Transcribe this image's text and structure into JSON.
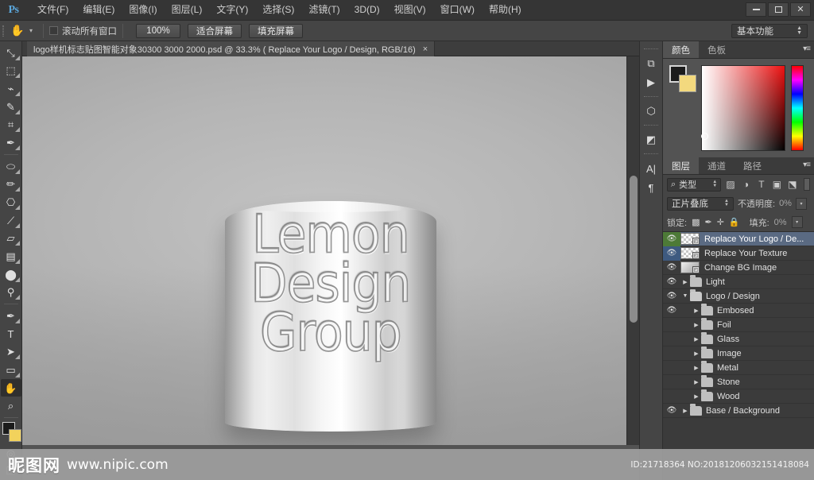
{
  "app": {
    "logo": "Ps",
    "window_controls": {
      "minimize": "—",
      "maximize": "❐",
      "close": "✕"
    }
  },
  "menubar": {
    "items": [
      {
        "label": "文件(F)"
      },
      {
        "label": "编辑(E)"
      },
      {
        "label": "图像(I)"
      },
      {
        "label": "图层(L)"
      },
      {
        "label": "文字(Y)"
      },
      {
        "label": "选择(S)"
      },
      {
        "label": "滤镜(T)"
      },
      {
        "label": "3D(D)"
      },
      {
        "label": "视图(V)"
      },
      {
        "label": "窗口(W)"
      },
      {
        "label": "帮助(H)"
      }
    ]
  },
  "options_bar": {
    "tool_icon": "hand-tool-icon",
    "scroll_all_windows_label": "滚动所有窗口",
    "scroll_all_windows_checked": false,
    "buttons": [
      {
        "label": "100%"
      },
      {
        "label": "适合屏幕"
      },
      {
        "label": "填充屏幕"
      }
    ],
    "workspace": {
      "value": "基本功能"
    }
  },
  "toolbar": {
    "tools": [
      {
        "name": "move-tool",
        "glyph": "↖"
      },
      {
        "name": "rectangular-marquee-tool",
        "glyph": "⬚"
      },
      {
        "name": "lasso-tool",
        "glyph": "☄"
      },
      {
        "name": "quick-selection-tool",
        "glyph": "✎"
      },
      {
        "name": "crop-tool",
        "glyph": "⛏"
      },
      {
        "name": "eyedropper-tool",
        "glyph": "✐"
      },
      {
        "name": "spot-healing-brush-tool",
        "glyph": "Ὀa"
      },
      {
        "name": "brush-tool",
        "glyph": "✏"
      },
      {
        "name": "clone-stamp-tool",
        "glyph": "⚒"
      },
      {
        "name": "history-brush-tool",
        "glyph": "☙"
      },
      {
        "name": "eraser-tool",
        "glyph": "▱"
      },
      {
        "name": "gradient-tool",
        "glyph": "▤"
      },
      {
        "name": "blur-tool",
        "glyph": "●"
      },
      {
        "name": "dodge-tool",
        "glyph": "⚲"
      },
      {
        "name": "pen-tool",
        "glyph": "✒"
      },
      {
        "name": "horizontal-type-tool",
        "glyph": "T"
      },
      {
        "name": "path-selection-tool",
        "glyph": "➤"
      },
      {
        "name": "rectangle-shape-tool",
        "glyph": "▭"
      },
      {
        "name": "hand-tool",
        "glyph": "✋",
        "active": true
      },
      {
        "name": "zoom-tool",
        "glyph": "⌕"
      }
    ],
    "quick_mask_glyph": "◎",
    "screen_mode_glyph": "❐",
    "foreground_color": "#1b1b1b",
    "background_color": "#f2d25c"
  },
  "document": {
    "tab_title": "logo样机标志贴图智能对象30300 3000 2000.psd @ 33.3% ( Replace Your Logo / Design, RGB/16)",
    "close_glyph": "×"
  },
  "canvas": {
    "mockup_text": "Lemon\nDesign\nGroup"
  },
  "icon_dock": {
    "icons": [
      {
        "name": "history-panel-icon",
        "glyph": "⧉"
      },
      {
        "name": "actions-play-icon",
        "glyph": "▶"
      },
      {
        "name": "3d-panel-icon",
        "glyph": "⬡"
      },
      {
        "name": "adjustments-panel-icon",
        "glyph": "◧"
      },
      {
        "name": "character-panel-icon",
        "glyph": "A"
      },
      {
        "name": "paragraph-panel-icon",
        "glyph": "¶"
      }
    ]
  },
  "color_panel": {
    "tabs": [
      {
        "label": "颜色",
        "active": true
      },
      {
        "label": "色板",
        "active": false
      }
    ],
    "menu_glyph": "▾≡",
    "foreground_color": "#1c1c1c",
    "background_color": "#f3d97e",
    "picker_base_color": "#ee1111"
  },
  "layers_panel": {
    "tabs": [
      {
        "label": "图层",
        "active": true
      },
      {
        "label": "通道",
        "active": false
      },
      {
        "label": "路径",
        "active": false
      }
    ],
    "menu_glyph": "▾≡",
    "filter": {
      "label": "类型",
      "search_glyph": "⌕"
    },
    "filter_icons": [
      {
        "name": "filter-pixel-icon",
        "glyph": "⛰"
      },
      {
        "name": "filter-adjustment-icon",
        "glyph": "◑"
      },
      {
        "name": "filter-type-icon",
        "glyph": "T"
      },
      {
        "name": "filter-shape-icon",
        "glyph": "▣"
      },
      {
        "name": "filter-smart-object-icon",
        "glyph": "⬚"
      }
    ],
    "blend_mode": "正片叠底",
    "opacity_label": "不透明度:",
    "opacity_value": "0%",
    "lock_label": "锁定:",
    "lock_icons": [
      {
        "name": "lock-transparent-pixels-icon",
        "glyph": "▒"
      },
      {
        "name": "lock-image-pixels-icon",
        "glyph": "✐"
      },
      {
        "name": "lock-position-icon",
        "glyph": "✛"
      },
      {
        "name": "lock-all-icon",
        "glyph": "🔒"
      }
    ],
    "fill_label": "填充:",
    "fill_value": "0%",
    "layers": [
      {
        "name": "Replace Your Logo / De...",
        "visible": true,
        "type": "smart-object",
        "selected": true,
        "eye_color": "green",
        "indent": 0
      },
      {
        "name": "Replace Your Texture",
        "visible": true,
        "type": "smart-object",
        "selected": false,
        "eye_color": "blue",
        "indent": 0
      },
      {
        "name": "Change BG Image",
        "visible": true,
        "type": "smart-object-gray",
        "selected": false,
        "eye_color": "none",
        "indent": 0
      },
      {
        "name": "Light",
        "visible": true,
        "type": "group",
        "selected": false,
        "eye_color": "none",
        "indent": 0
      },
      {
        "name": "Logo / Design",
        "visible": true,
        "type": "group-open",
        "selected": false,
        "eye_color": "none",
        "indent": 0
      },
      {
        "name": "Embosed",
        "visible": true,
        "type": "group",
        "selected": false,
        "eye_color": "none",
        "indent": 1
      },
      {
        "name": "Foil",
        "visible": false,
        "type": "group",
        "selected": false,
        "eye_color": "none",
        "indent": 1
      },
      {
        "name": "Glass",
        "visible": false,
        "type": "group",
        "selected": false,
        "eye_color": "none",
        "indent": 1
      },
      {
        "name": "Image",
        "visible": false,
        "type": "group",
        "selected": false,
        "eye_color": "none",
        "indent": 1
      },
      {
        "name": "Metal",
        "visible": false,
        "type": "group",
        "selected": false,
        "eye_color": "none",
        "indent": 1
      },
      {
        "name": "Stone",
        "visible": false,
        "type": "group",
        "selected": false,
        "eye_color": "none",
        "indent": 1
      },
      {
        "name": "Wood",
        "visible": false,
        "type": "group",
        "selected": false,
        "eye_color": "none",
        "indent": 1
      },
      {
        "name": "Base / Background",
        "visible": true,
        "type": "group",
        "selected": false,
        "eye_color": "none",
        "indent": 0
      }
    ]
  },
  "watermark": {
    "logo_text": "昵图网",
    "url": "www.nipic.com",
    "id_text": "ID:21718364 NO:20181206032151418084"
  }
}
